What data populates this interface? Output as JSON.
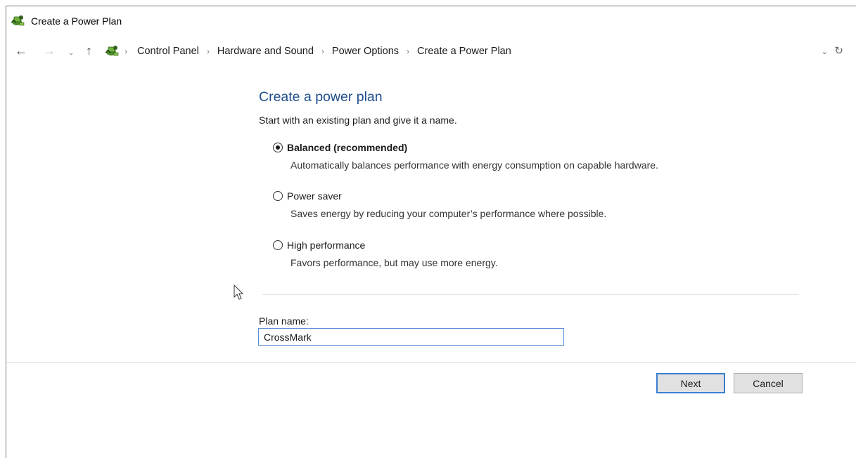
{
  "window": {
    "title": "Create a Power Plan",
    "title_icon": "power-options-icon"
  },
  "address_bar": {
    "back_icon": "←",
    "forward_icon": "→",
    "recent_icon": "⌄",
    "up_icon": "↑",
    "breadcrumbs": [
      {
        "label": "Control Panel"
      },
      {
        "label": "Hardware and Sound"
      },
      {
        "label": "Power Options"
      },
      {
        "label": "Create a Power Plan"
      }
    ],
    "separator": "›",
    "dropdown_icon": "⌄",
    "refresh_icon": "↻"
  },
  "main": {
    "heading": "Create a power plan",
    "intro": "Start with an existing plan and give it a name.",
    "options": [
      {
        "label": "Balanced (recommended)",
        "description": "Automatically balances performance with energy consumption on capable hardware.",
        "checked": true
      },
      {
        "label": "Power saver",
        "description": "Saves energy by reducing your computer’s performance where possible.",
        "checked": false
      },
      {
        "label": "High performance",
        "description": "Favors performance, but may use more energy.",
        "checked": false
      }
    ],
    "plan_name_label": "Plan name:",
    "plan_name_value": "CrossMark"
  },
  "footer": {
    "next_label": "Next",
    "cancel_label": "Cancel"
  },
  "colors": {
    "heading": "#1e4e8c",
    "focus_border": "#3c7fd0"
  }
}
